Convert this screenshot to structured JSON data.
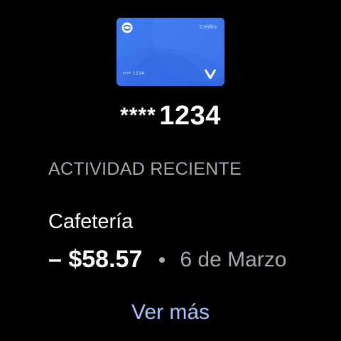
{
  "card": {
    "type_label": "Crédito",
    "number_short": "•••• 1234",
    "logo_icon": "payment-app-logo-icon",
    "brand_icon": "card-network-v-icon",
    "colors": {
      "base": "#3a73ec",
      "accent": "#4d88f4"
    }
  },
  "masked_number": {
    "stars": "****",
    "last_digits": "1234"
  },
  "recent_activity": {
    "title": "ACTIVIDAD RECIENTE",
    "transaction": {
      "merchant": "Cafetería",
      "amount": "– $58.57",
      "date": "6 de Marzo"
    }
  },
  "actions": {
    "see_more_label": "Ver más"
  },
  "colors": {
    "background": "#000000",
    "primary_text": "#ffffff",
    "secondary_text": "#a5a9b0",
    "link": "#a8c4ff"
  }
}
